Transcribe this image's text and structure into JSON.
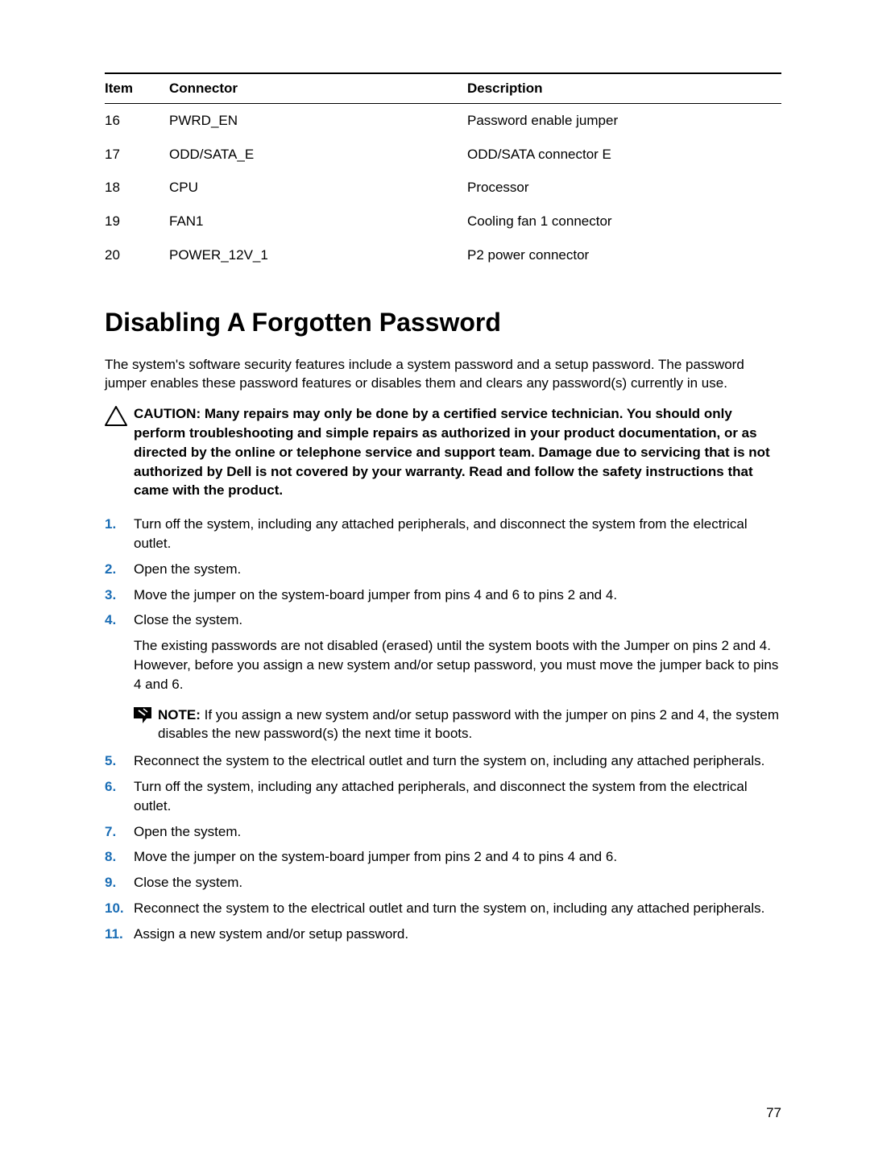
{
  "table": {
    "headers": {
      "item": "Item",
      "connector": "Connector",
      "description": "Description"
    },
    "rows": [
      {
        "item": "16",
        "connector": "PWRD_EN",
        "description": "Password enable jumper"
      },
      {
        "item": "17",
        "connector": "ODD/SATA_E",
        "description": "ODD/SATA connector E"
      },
      {
        "item": "18",
        "connector": "CPU",
        "description": "Processor"
      },
      {
        "item": "19",
        "connector": "FAN1",
        "description": "Cooling fan 1 connector"
      },
      {
        "item": "20",
        "connector": "POWER_12V_1",
        "description": "P2 power connector"
      }
    ]
  },
  "section": {
    "title": "Disabling A Forgotten Password",
    "intro": "The system's software security features include a system password and a setup password. The password jumper enables these password features or disables them and clears any password(s) currently in use.",
    "caution_prefix": "CAUTION: ",
    "caution": "Many repairs may only be done by a certified service technician. You should only perform troubleshooting and simple repairs as authorized in your product documentation, or as directed by the online or telephone service and support team. Damage due to servicing that is not authorized by Dell is not covered by your warranty. Read and follow the safety instructions that came with the product.",
    "steps": {
      "s1": "Turn off the system, including any attached peripherals, and disconnect the system from the electrical outlet.",
      "s2": "Open the system.",
      "s3": "Move the jumper on the system-board jumper from pins 4 and 6 to pins 2 and 4.",
      "s4": "Close the system.",
      "s4_sub": "The existing passwords are not disabled (erased) until the system boots with the Jumper on pins 2 and 4. However, before you assign a new system and/or setup password, you must move the jumper back to pins 4 and 6.",
      "note_prefix": "NOTE: ",
      "note": "If you assign a new system and/or setup password with the jumper on pins 2 and 4, the system disables the new password(s) the next time it boots.",
      "s5": "Reconnect the system to the electrical outlet and turn the system on, including any attached peripherals.",
      "s6": "Turn off the system, including any attached peripherals, and disconnect the system from the electrical outlet.",
      "s7": "Open the system.",
      "s8": "Move the jumper on the system-board jumper from pins 2 and 4 to pins 4 and 6.",
      "s9": "Close the system.",
      "s10": "Reconnect the system to the electrical outlet and turn the system on, including any attached peripherals.",
      "s11": "Assign a new system and/or setup password."
    }
  },
  "page_number": "77"
}
